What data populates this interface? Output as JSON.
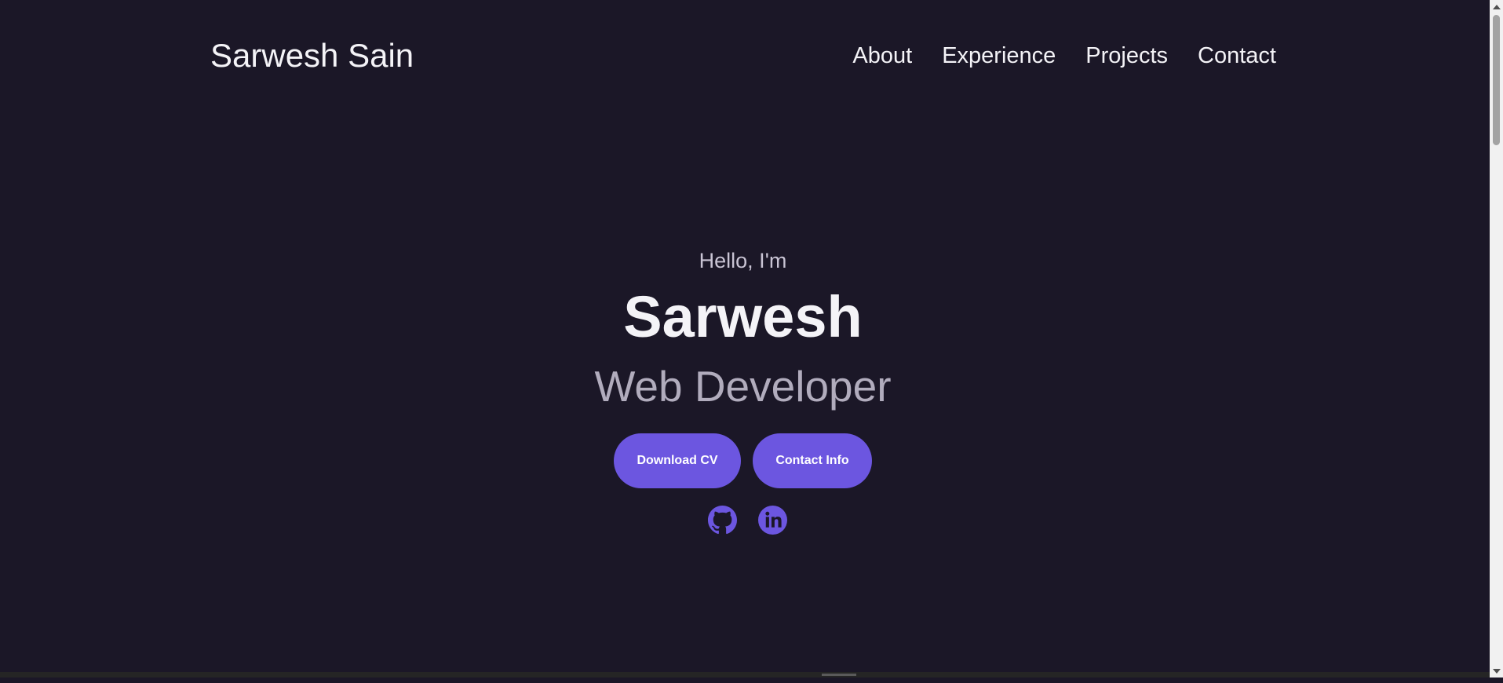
{
  "header": {
    "brand": "Sarwesh Sain",
    "nav": [
      {
        "label": "About"
      },
      {
        "label": "Experience"
      },
      {
        "label": "Projects"
      },
      {
        "label": "Contact"
      }
    ]
  },
  "hero": {
    "greeting": "Hello, I'm",
    "name": "Sarwesh",
    "role": "Web Developer",
    "buttons": {
      "download_cv": "Download CV",
      "contact_info": "Contact Info"
    },
    "socials": [
      "github-icon",
      "linkedin-icon"
    ]
  },
  "colors": {
    "background": "#1b1727",
    "accent": "#6c56e0",
    "text_primary": "#f4f3f7",
    "text_muted": "#b1acbd"
  }
}
